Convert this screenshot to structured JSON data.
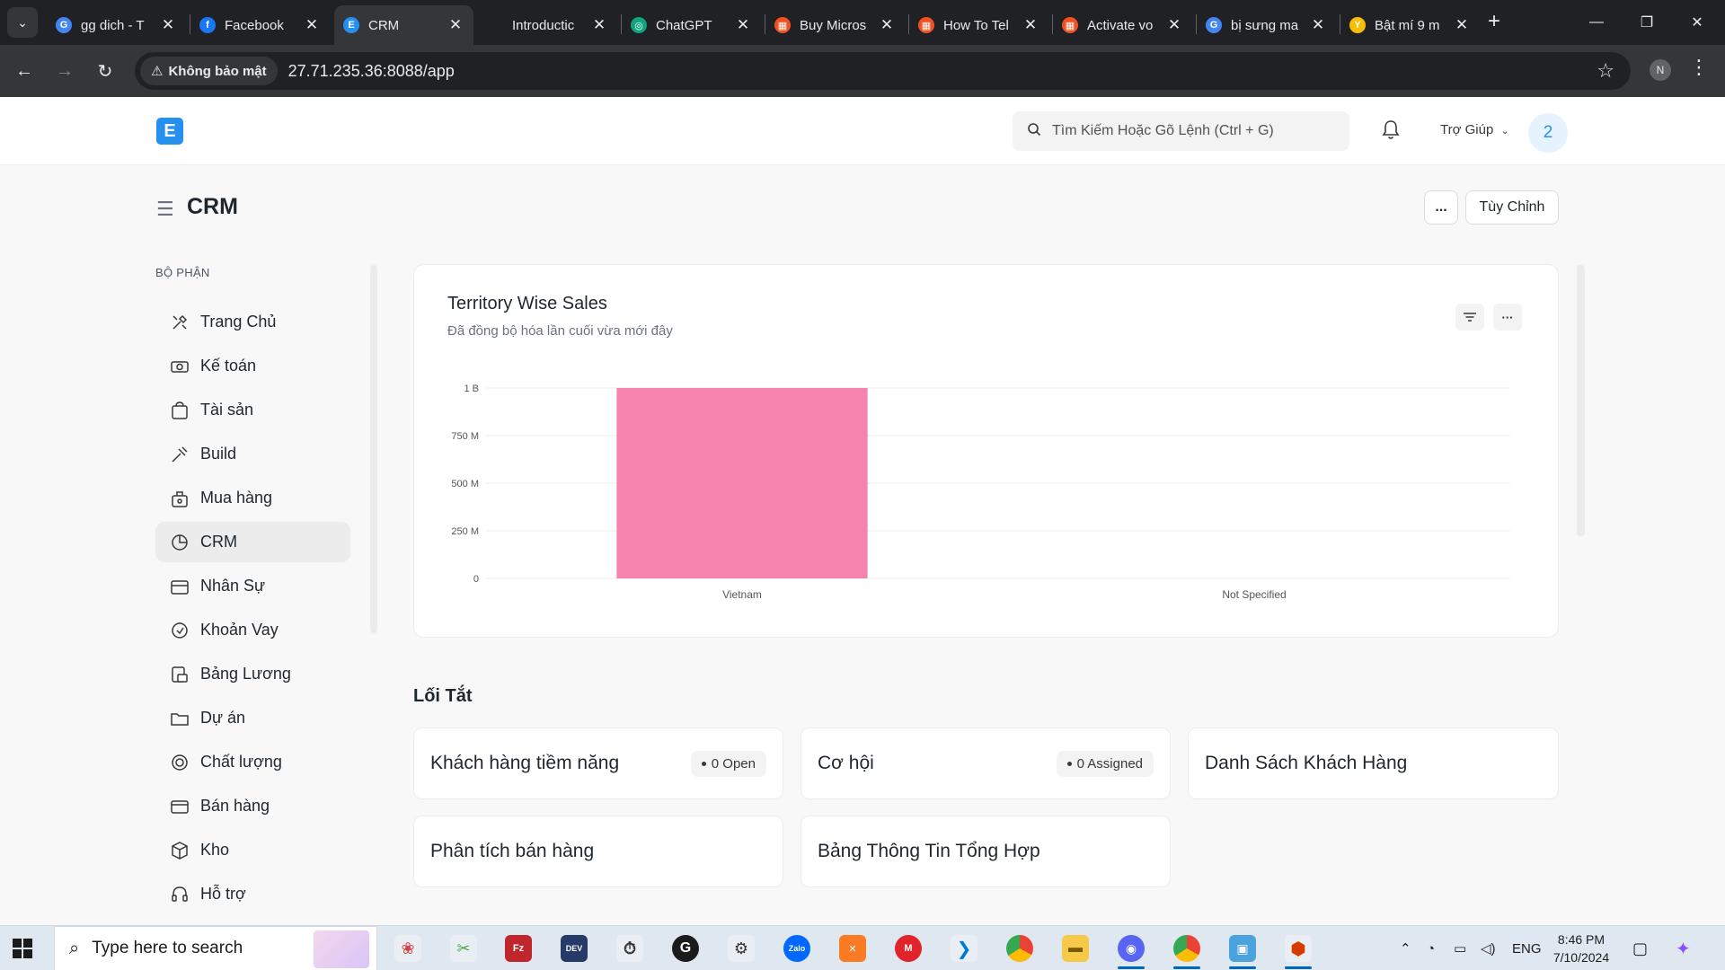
{
  "browser": {
    "tabs": [
      {
        "label": "gg dich - T",
        "favicon": "google-icon",
        "color": "#4285f4",
        "glyph": "G",
        "active": false
      },
      {
        "label": "Facebook",
        "favicon": "facebook-icon",
        "color": "#1877f2",
        "glyph": "f",
        "active": false
      },
      {
        "label": "CRM",
        "favicon": "erpnext-icon",
        "color": "#2490ef",
        "glyph": "E",
        "active": true
      },
      {
        "label": "Introductic",
        "favicon": "blank-icon",
        "color": "#202124",
        "glyph": "",
        "active": false
      },
      {
        "label": "ChatGPT",
        "favicon": "chatgpt-icon",
        "color": "#10a37f",
        "glyph": "◎",
        "active": false
      },
      {
        "label": "Buy Micros",
        "favicon": "microsoft-icon",
        "color": "#f25022",
        "glyph": "▦",
        "active": false
      },
      {
        "label": "How To Tel",
        "favicon": "microsoft-icon",
        "color": "#f25022",
        "glyph": "▦",
        "active": false
      },
      {
        "label": "Activate vo",
        "favicon": "microsoft-icon",
        "color": "#f25022",
        "glyph": "▦",
        "active": false
      },
      {
        "label": "bị sưng ma",
        "favicon": "google-icon",
        "color": "#4285f4",
        "glyph": "G",
        "active": false
      },
      {
        "label": "Bật mí 9 m",
        "favicon": "yandex-icon",
        "color": "#fbbc04",
        "glyph": "Y",
        "active": false
      }
    ],
    "security_label": "Không bảo mật",
    "url": "27.71.235.36:8088/app",
    "profile_initial": "N"
  },
  "navbar": {
    "search_placeholder": "Tìm Kiếm Hoặc Gõ Lệnh (Ctrl + G)",
    "help_label": "Trợ Giúp",
    "avatar_text": "2",
    "logo_text": "E"
  },
  "page": {
    "title": "CRM",
    "more_label": "...",
    "customize_label": "Tùy Chỉnh"
  },
  "sidebar": {
    "heading": "BỘ PHẬN",
    "items": [
      {
        "label": "Trang Chủ",
        "icon": "tools-icon",
        "active": false
      },
      {
        "label": "Kế toán",
        "icon": "money-icon",
        "active": false
      },
      {
        "label": "Tài sản",
        "icon": "bag-icon",
        "active": false
      },
      {
        "label": "Build",
        "icon": "wrench-icon",
        "active": false
      },
      {
        "label": "Mua hàng",
        "icon": "basket-icon",
        "active": false
      },
      {
        "label": "CRM",
        "icon": "pie-icon",
        "active": true
      },
      {
        "label": "Nhân Sự",
        "icon": "id-card-icon",
        "active": false
      },
      {
        "label": "Khoản Vay",
        "icon": "loan-icon",
        "active": false
      },
      {
        "label": "Bảng Lương",
        "icon": "payroll-icon",
        "active": false
      },
      {
        "label": "Dự án",
        "icon": "folder-icon",
        "active": false
      },
      {
        "label": "Chất lượng",
        "icon": "quality-icon",
        "active": false
      },
      {
        "label": "Bán hàng",
        "icon": "card-icon",
        "active": false
      },
      {
        "label": "Kho",
        "icon": "box-icon",
        "active": false
      },
      {
        "label": "Hỗ trợ",
        "icon": "headset-icon",
        "active": false
      }
    ]
  },
  "chart_card": {
    "title": "Territory Wise Sales",
    "subtitle": "Đã đồng bộ hóa lần cuối vừa mới đây"
  },
  "chart_data": {
    "type": "bar",
    "title": "Territory Wise Sales",
    "categories": [
      "Vietnam",
      "Not Specified"
    ],
    "values": [
      1000000000,
      0
    ],
    "ylim": [
      0,
      1000000000
    ],
    "yticks": [
      {
        "value": 0,
        "label": "0"
      },
      {
        "value": 250000000,
        "label": "250 M"
      },
      {
        "value": 500000000,
        "label": "500 M"
      },
      {
        "value": 750000000,
        "label": "750 M"
      },
      {
        "value": 1000000000,
        "label": "1 B"
      }
    ],
    "bar_color": "#f683ae",
    "grid": true,
    "xlabel": "",
    "ylabel": ""
  },
  "shortcuts": {
    "title": "Lối Tắt",
    "items": [
      {
        "label": "Khách hàng tiềm năng",
        "badge": "0 Open"
      },
      {
        "label": "Cơ hội",
        "badge": "0 Assigned"
      },
      {
        "label": "Danh Sách Khách Hàng",
        "badge": ""
      },
      {
        "label": "Phân tích bán hàng",
        "badge": ""
      },
      {
        "label": "Bảng Thông Tin Tổng Hợp",
        "badge": ""
      }
    ]
  },
  "taskbar": {
    "search_placeholder": "Type here to search",
    "language": "ENG",
    "time": "8:46 PM",
    "date": "7/10/2024"
  }
}
